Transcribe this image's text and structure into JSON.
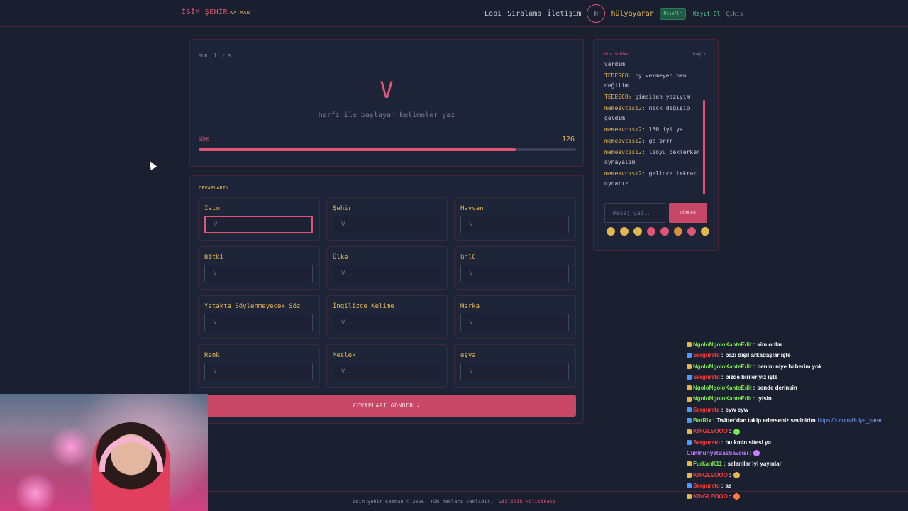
{
  "header": {
    "brand": "İSİM ŞEHİR",
    "brand_sub": "KATMAN",
    "nav": [
      "Lobi",
      "Sıralama",
      "İletişim"
    ],
    "avatar_initial": "H",
    "username": "hülyayarar",
    "guest_badge": "Misafir",
    "register": "Kayıt Ol",
    "logout": "Çıkış"
  },
  "round": {
    "label": "TUR",
    "current": "1",
    "total": "/ 3",
    "letter": "V",
    "instruction": "harfi ile başlayan kelimeler yaz",
    "time_label": "SÜRE",
    "time_left": "126",
    "time_progress": 0.84
  },
  "answers": {
    "title": "CEVAPLARIN",
    "placeholder": "V...",
    "categories": [
      "İsim",
      "Şehir",
      "Hayvan",
      "Bitki",
      "Ülke",
      "ünlü",
      "Yatakta Söylenmeyecek Söz",
      "İngilizce Kelime",
      "Marka",
      "Renk",
      "Meslek",
      "eşya"
    ],
    "submit": "CEVAPLARI GÖNDER ✓"
  },
  "chat": {
    "title": "Oda Sohbet",
    "status": "bağlı",
    "messages": [
      {
        "nick": "",
        "text": "verdim"
      },
      {
        "nick": "TEDESCO:",
        "text": "oy vermeyen ben değilim"
      },
      {
        "nick": "TEDESCO:",
        "text": "şimdiden yazıyım"
      },
      {
        "nick": "memeavcısı2:",
        "text": "nick değişip geldim"
      },
      {
        "nick": "memeavcısı2:",
        "text": "150 iyi ya"
      },
      {
        "nick": "memeavcısı2:",
        "text": "go brrr"
      },
      {
        "nick": "memeavcısı2:",
        "text": "leoyu beklerken oynayalım"
      },
      {
        "nick": "memeavcısı2:",
        "text": "gelince tekrar oynarız"
      }
    ],
    "input_placeholder": "Mesaj yaz..",
    "send": "GÖNDER",
    "emojis": [
      "#e4b74f",
      "#e4b74f",
      "#e4b74f",
      "#e05575",
      "#e05575",
      "#d9903a",
      "#e05575",
      "#e4b74f"
    ]
  },
  "footer": {
    "copyright": "İsim Şehir Katman © 2026. Tüm hakları saklıdır.",
    "policy": "Gizlilik Politikası"
  },
  "stream_chat": [
    {
      "user": "NgoloNgoloKanteEdit",
      "color": "#7de84a",
      "badge": "#e4b74f",
      "msg": "kim onlar"
    },
    {
      "user": "Sergureto",
      "color": "#ff3b3b",
      "badge": "#4a9bff",
      "msg": "bazı dişil arkadaşlar işte"
    },
    {
      "user": "NgoloNgoloKanteEdit",
      "color": "#7de84a",
      "badge": "#e4b74f",
      "msg": "benim niye haberim yok"
    },
    {
      "user": "Sergureto",
      "color": "#ff3b3b",
      "badge": "#4a9bff",
      "msg": "bizde birileriyiz işte"
    },
    {
      "user": "NgoloNgoloKanteEdit",
      "color": "#7de84a",
      "badge": "#e4b74f",
      "msg": "sende derinsin"
    },
    {
      "user": "NgoloNgoloKanteEdit",
      "color": "#7de84a",
      "badge": "#e4b74f",
      "msg": "iyisin"
    },
    {
      "user": "Sergureto",
      "color": "#ff3b3b",
      "badge": "#4a9bff",
      "msg": "eyw eyw"
    },
    {
      "user": "BotRix",
      "color": "#7de84a",
      "badge": "#4a9bff",
      "msg": "Twitter'dan takip ederseniz sevinirim",
      "link": "https://x.com/Hulya_yarar"
    },
    {
      "user": "KINGLEOOO",
      "color": "#ff3b3b",
      "badge": "#e4b74f",
      "msg": "",
      "emote": "#7de84a"
    },
    {
      "user": "Sergureto",
      "color": "#ff3b3b",
      "badge": "#4a9bff",
      "msg": "bu kmin sitesi ya"
    },
    {
      "user": "CumhuriyetBasSavcisi",
      "color": "#c77dff",
      "badge": "",
      "msg": "",
      "emote": "#c77dff"
    },
    {
      "user": "FurkanK11",
      "color": "#7de84a",
      "badge": "#e4b74f",
      "msg": "selamlar iyi yayınlar"
    },
    {
      "user": "KINGLEOOO",
      "color": "#ff3b3b",
      "badge": "#e4b74f",
      "msg": "",
      "emote": "#e4b74f"
    },
    {
      "user": "Sergureto",
      "color": "#ff3b3b",
      "badge": "#4a9bff",
      "msg": "as"
    },
    {
      "user": "KINGLEOOO",
      "color": "#ff3b3b",
      "badge": "#e4b74f",
      "msg": "",
      "emote": "#ff7a3b"
    }
  ]
}
